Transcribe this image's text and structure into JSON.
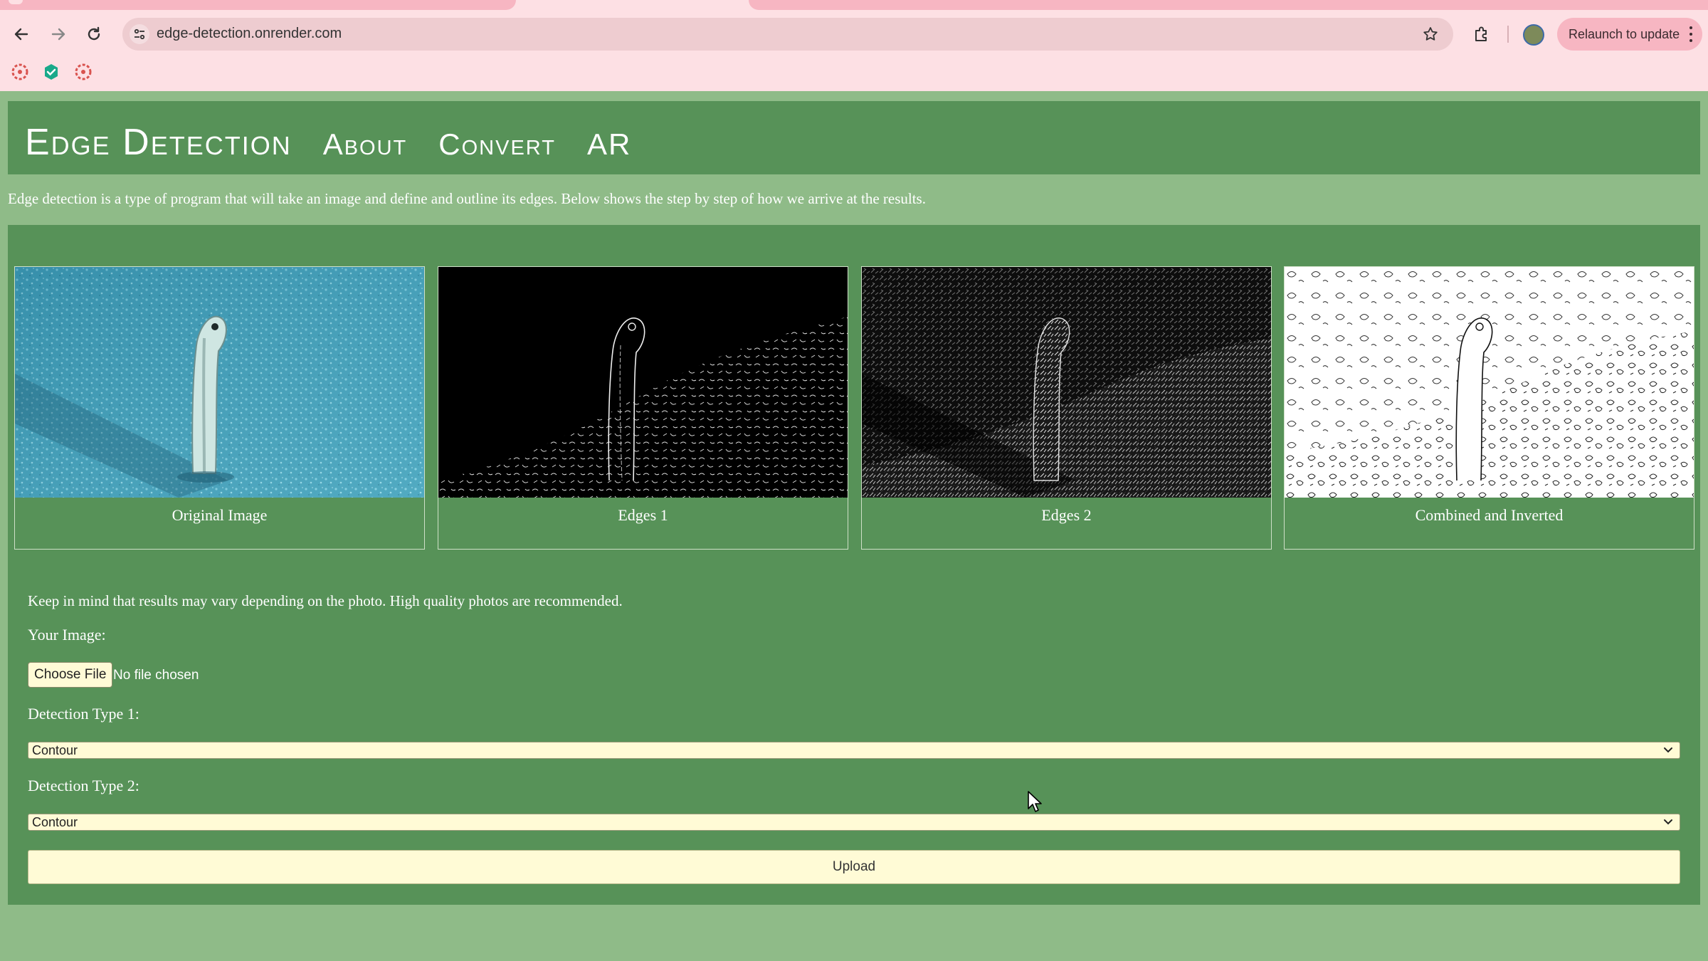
{
  "browser": {
    "url": "edge-detection.onrender.com",
    "relaunch_label": "Relaunch to update"
  },
  "site": {
    "brand": "Edge Detection",
    "nav": [
      "About",
      "Convert",
      "AR"
    ]
  },
  "intro": "Edge detection is a type of program that will take an image and define and outline its edges. Below shows the step by step of how we arrive at the results.",
  "cards": [
    {
      "caption": "Original Image"
    },
    {
      "caption": "Edges 1"
    },
    {
      "caption": "Edges 2"
    },
    {
      "caption": "Combined and Inverted"
    }
  ],
  "form": {
    "note": "Keep in mind that results may vary depending on the photo. High quality photos are recommended.",
    "image_label": "Your Image:",
    "choose_file": "Choose File",
    "file_status": "No file chosen",
    "type1_label": "Detection Type 1:",
    "type1_value": "Contour",
    "type2_label": "Detection Type 2:",
    "type2_value": "Contour",
    "upload_label": "Upload"
  },
  "icons": [
    "back-arrow-icon",
    "forward-arrow-icon",
    "reload-icon",
    "tune-icon",
    "star-icon",
    "extensions-icon",
    "profile-icon",
    "kebab-menu-icon",
    "chevron-down-icon",
    "cursor-icon"
  ]
}
